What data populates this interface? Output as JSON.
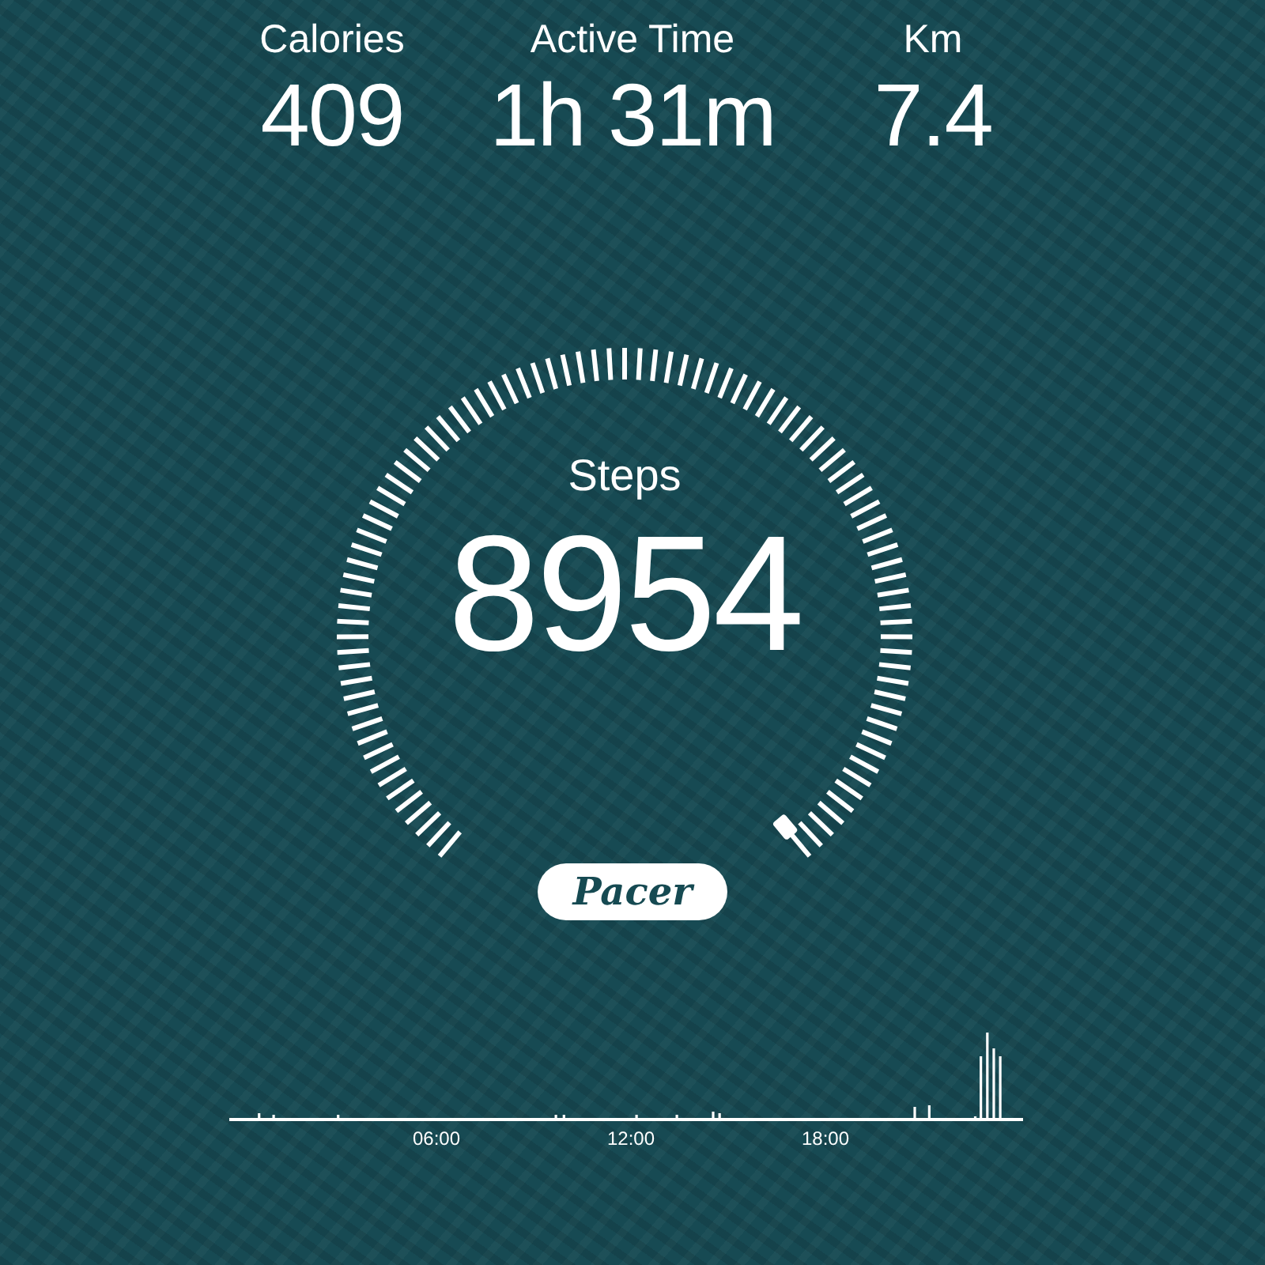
{
  "stats": [
    {
      "label": "Calories",
      "value": "409"
    },
    {
      "label": "Active Time",
      "value": "1h 31m"
    },
    {
      "label": "Km",
      "value": "7.4"
    }
  ],
  "gauge": {
    "label": "Steps",
    "value": "8954"
  },
  "logo": "Pacer",
  "activity_chart": {
    "hour_labels": [
      "06:00",
      "12:00",
      "18:00"
    ]
  }
}
